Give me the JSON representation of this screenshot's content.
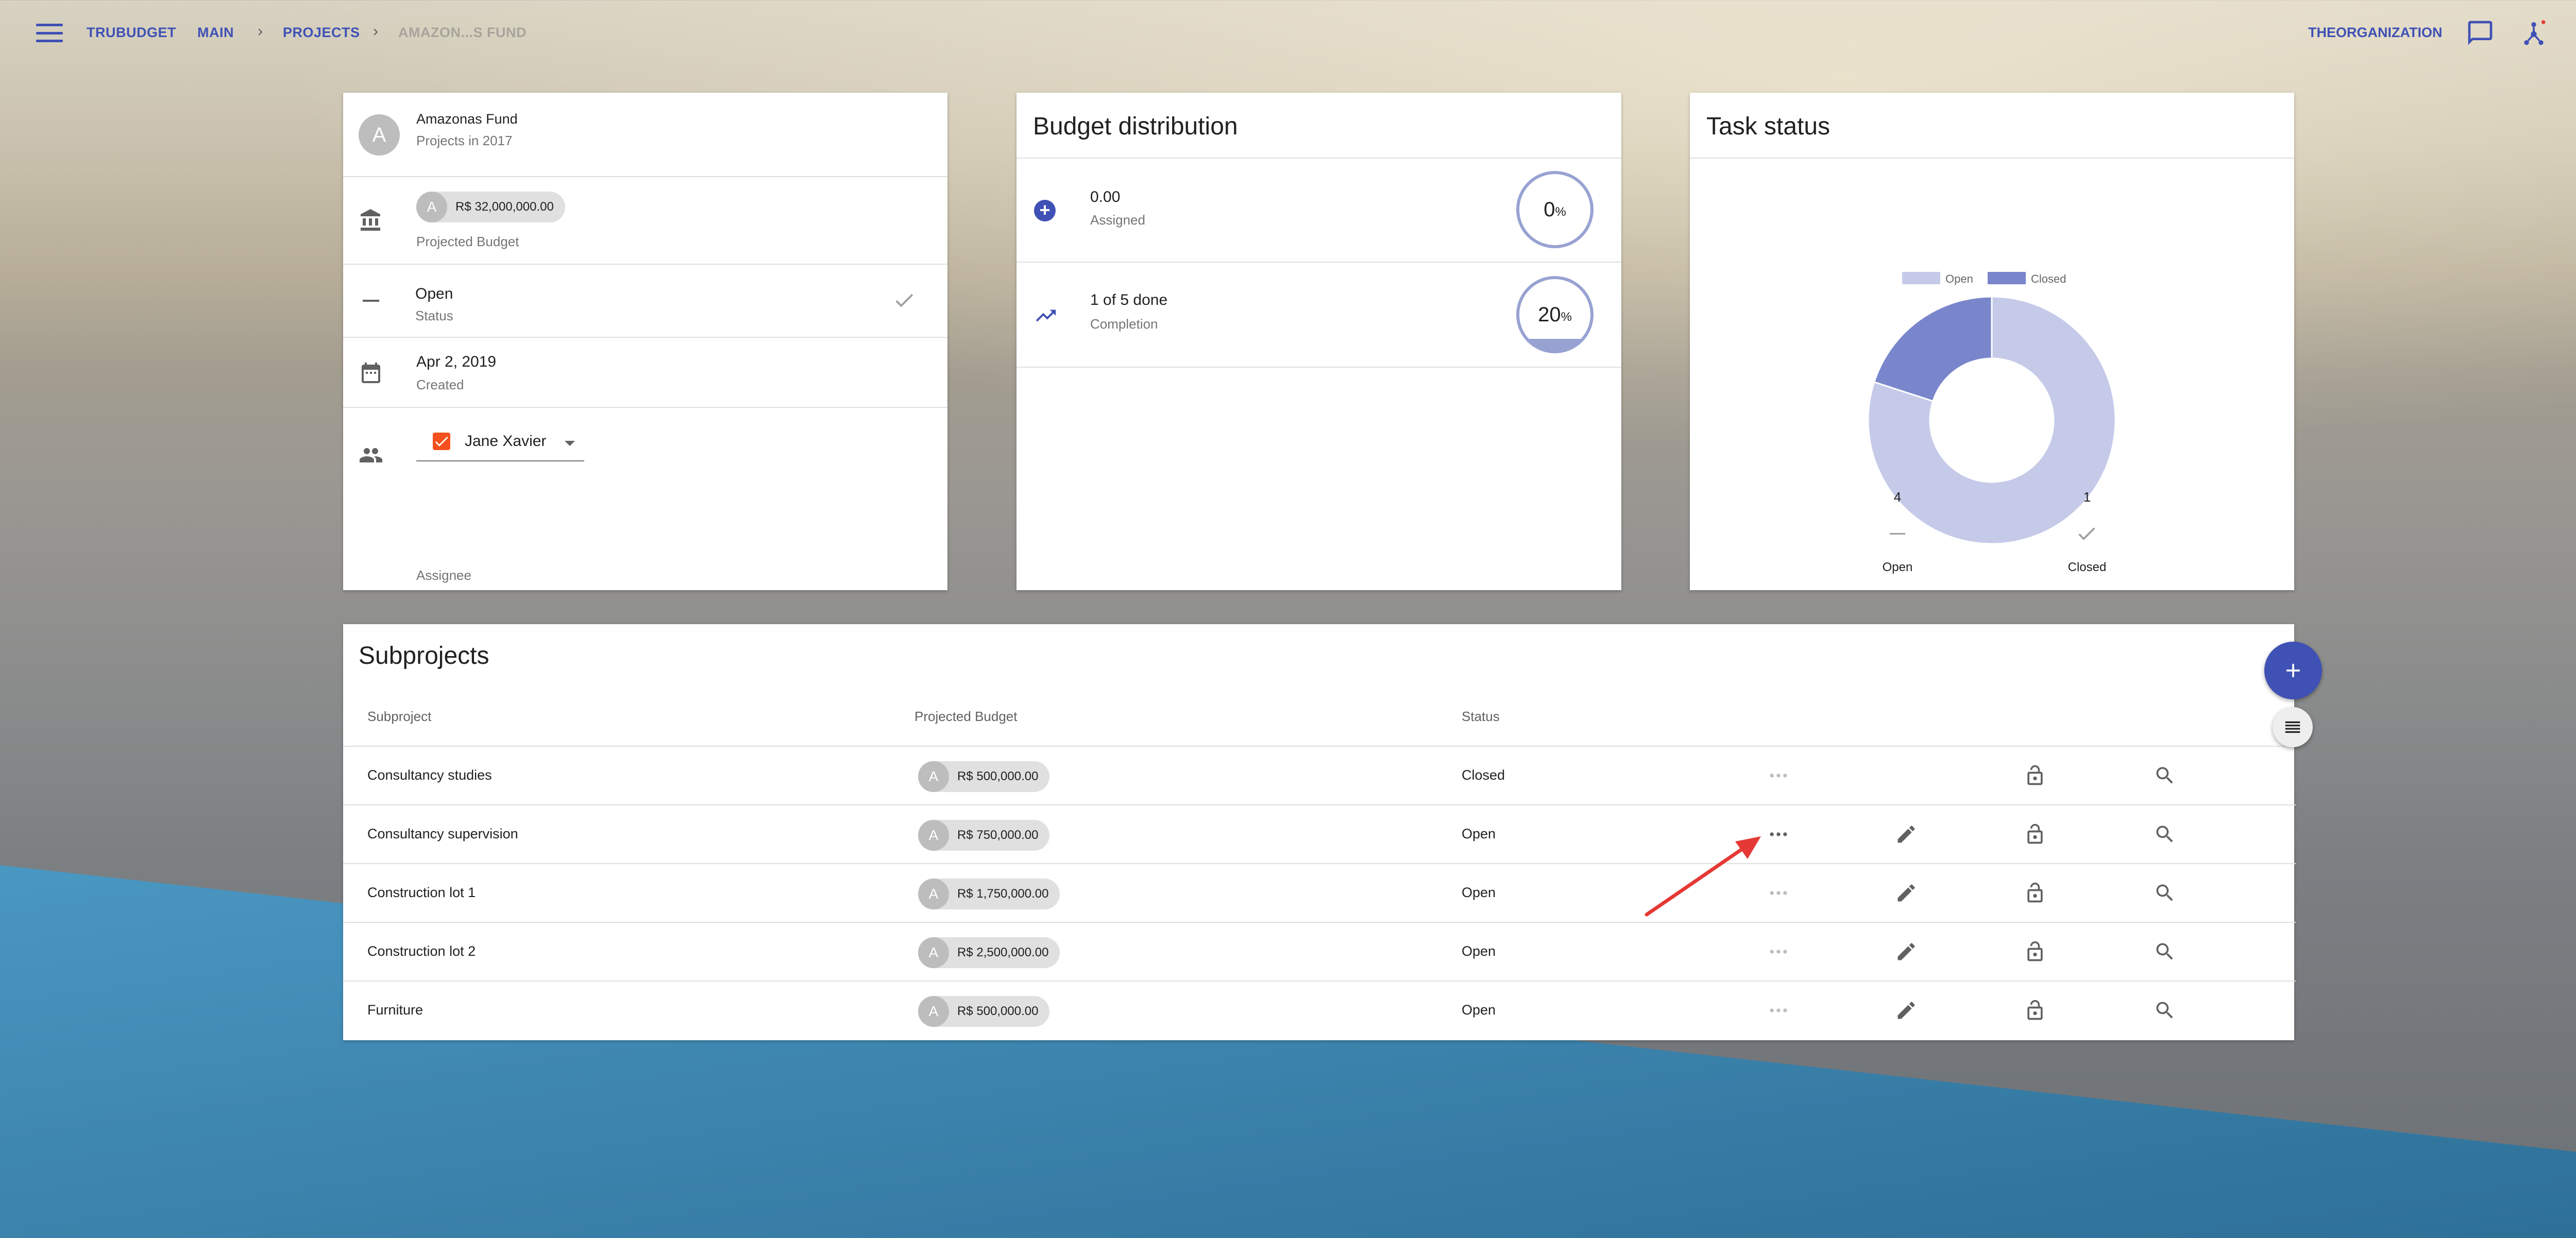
{
  "breadcrumbs": [
    "TRUBUDGET",
    "MAIN",
    "PROJECTS",
    "AMAZON...S FUND"
  ],
  "header": {
    "organization": "THEORGANIZATION"
  },
  "project": {
    "avatar_letter": "A",
    "name": "Amazonas Fund",
    "subtitle": "Projects in 2017",
    "budget_chip_letter": "A",
    "budget_value": "R$ 32,000,000.00",
    "budget_label": "Projected Budget",
    "status_value": "Open",
    "status_label": "Status",
    "created_value": "Apr 2, 2019",
    "created_label": "Created",
    "assignee_value": "Jane Xavier",
    "assignee_label": "Assignee"
  },
  "budget_distribution": {
    "title": "Budget distribution",
    "assigned_value": "0.00",
    "assigned_label": "Assigned",
    "assigned_percent": "0",
    "completion_value": "1 of 5 done",
    "completion_label": "Completion",
    "completion_percent": "20",
    "percent_sign": "%"
  },
  "task_status": {
    "title": "Task status",
    "legend": [
      "Open",
      "Closed"
    ],
    "open_count": "4",
    "closed_count": "1",
    "open_label": "Open",
    "closed_label": "Closed"
  },
  "chart_data": {
    "type": "pie",
    "title": "Task status",
    "categories": [
      "Open",
      "Closed"
    ],
    "values": [
      4,
      1
    ],
    "colors": [
      "#c5cae9",
      "#7986cb"
    ],
    "legend": "top"
  },
  "subprojects": {
    "title": "Subprojects",
    "columns": [
      "Subproject",
      "Projected Budget",
      "Status"
    ],
    "rows": [
      {
        "name": "Consultancy studies",
        "letter": "A",
        "budget": "R$ 500,000.00",
        "status": "Closed"
      },
      {
        "name": "Consultancy supervision",
        "letter": "A",
        "budget": "R$ 750,000.00",
        "status": "Open"
      },
      {
        "name": "Construction lot 1",
        "letter": "A",
        "budget": "R$ 1,750,000.00",
        "status": "Open"
      },
      {
        "name": "Construction lot 2",
        "letter": "A",
        "budget": "R$ 2,500,000.00",
        "status": "Open"
      },
      {
        "name": "Furniture",
        "letter": "A",
        "budget": "R$ 500,000.00",
        "status": "Open"
      }
    ]
  },
  "colors": {
    "primary": "#3f51b5",
    "checkbox": "#f4511e",
    "annotation_arrow": "#e53935",
    "wave": "#3d86b0"
  }
}
